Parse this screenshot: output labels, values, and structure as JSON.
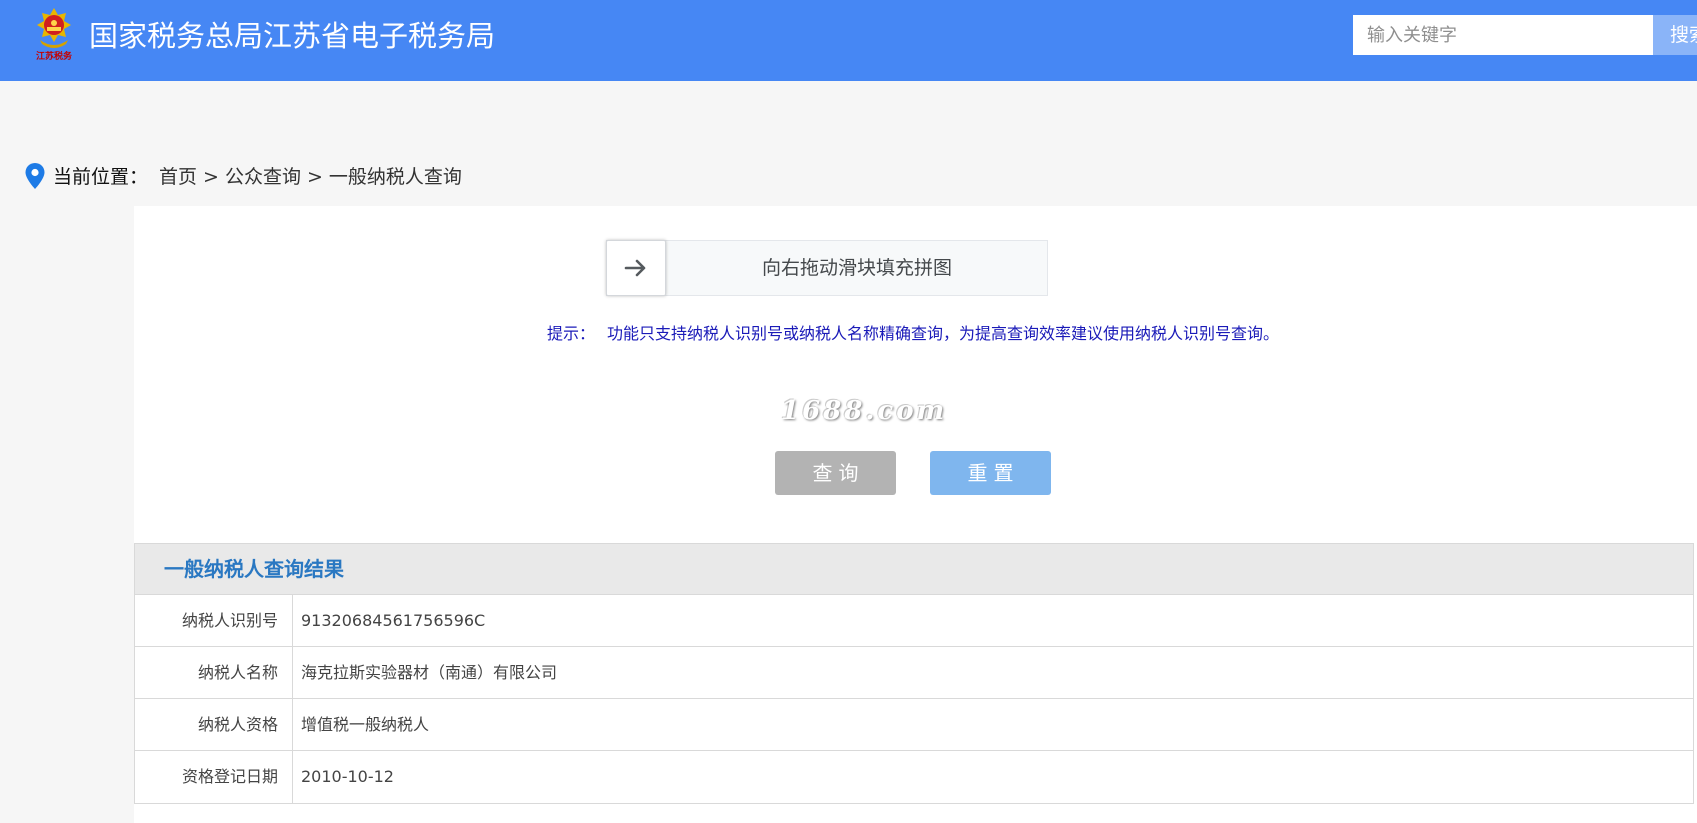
{
  "header": {
    "logo_caption": "江苏税务",
    "site_title": "国家税务总局江苏省电子税务局",
    "search_placeholder": "输入关键字",
    "search_button": "搜索"
  },
  "breadcrumb": {
    "prefix": "当前位置：",
    "items": [
      "首页",
      "公众查询",
      "一般纳税人查询"
    ],
    "separator": ">"
  },
  "captcha": {
    "icon": "arrow-right-icon",
    "instruction": "向右拖动滑块填充拼图"
  },
  "tip": {
    "label": "提示：",
    "text": "功能只支持纳税人识别号或纳税人名称精确查询，为提高查询效率建议使用纳税人识别号查询。"
  },
  "watermark": "1688.com",
  "buttons": {
    "query": "查询",
    "reset": "重置"
  },
  "result": {
    "title": "一般纳税人查询结果",
    "rows": [
      {
        "label": "纳税人识别号",
        "value": "91320684561756596C"
      },
      {
        "label": "纳税人名称",
        "value": "海克拉斯实验器材（南通）有限公司"
      },
      {
        "label": "纳税人资格",
        "value": "增值税一般纳税人"
      },
      {
        "label": "资格登记日期",
        "value": "2010-10-12"
      }
    ]
  },
  "colors": {
    "header_bg": "#4687f4",
    "result_title": "#2a78c2",
    "tip_text": "#1a1ab8",
    "query_button": "#b3b3b3",
    "reset_button": "#7fb6ee"
  }
}
